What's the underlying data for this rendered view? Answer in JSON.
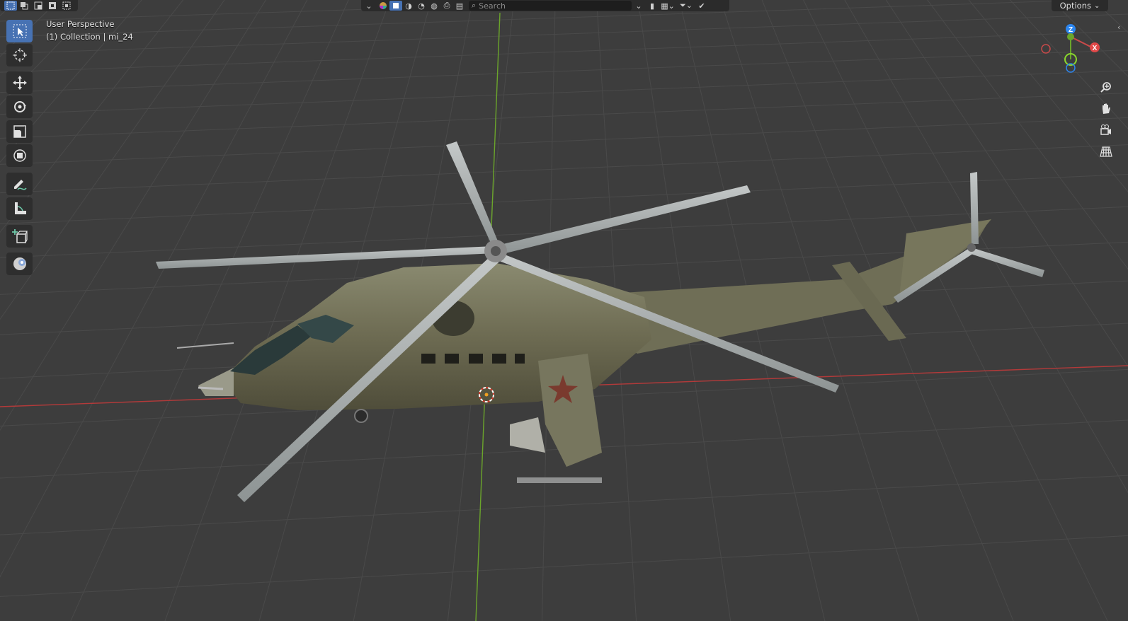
{
  "viewport": {
    "view_name": "User Perspective",
    "collection_info": "(1) Collection | mi_24"
  },
  "header": {
    "search_placeholder": "Search",
    "options_label": "Options"
  },
  "toolbar": {
    "tools": [
      {
        "name": "select-box-tool",
        "icon": "select-box-icon",
        "active": true
      },
      {
        "name": "cursor-tool",
        "icon": "cursor-icon",
        "active": false
      },
      {
        "name": "move-tool",
        "icon": "move-icon",
        "active": false
      },
      {
        "name": "rotate-tool",
        "icon": "rotate-icon",
        "active": false
      },
      {
        "name": "scale-tool",
        "icon": "scale-icon",
        "active": false
      },
      {
        "name": "transform-tool",
        "icon": "transform-icon",
        "active": false
      },
      {
        "name": "annotate-tool",
        "icon": "annotate-icon",
        "active": false
      },
      {
        "name": "measure-tool",
        "icon": "measure-icon",
        "active": false
      },
      {
        "name": "add-cube-tool",
        "icon": "add-cube-icon",
        "active": false
      },
      {
        "name": "shading-ball-tool",
        "icon": "shading-ball-icon",
        "active": false
      }
    ]
  },
  "gizmo": {
    "x_label": "X",
    "z_label": "Z"
  },
  "colors": {
    "background": "#3d3d3d",
    "grid": "#4a4a4a",
    "x_axis": "#b33a3a",
    "z_axis": "#6ba52b",
    "active_tool": "#4772b3",
    "header": "#2b2b2b"
  }
}
